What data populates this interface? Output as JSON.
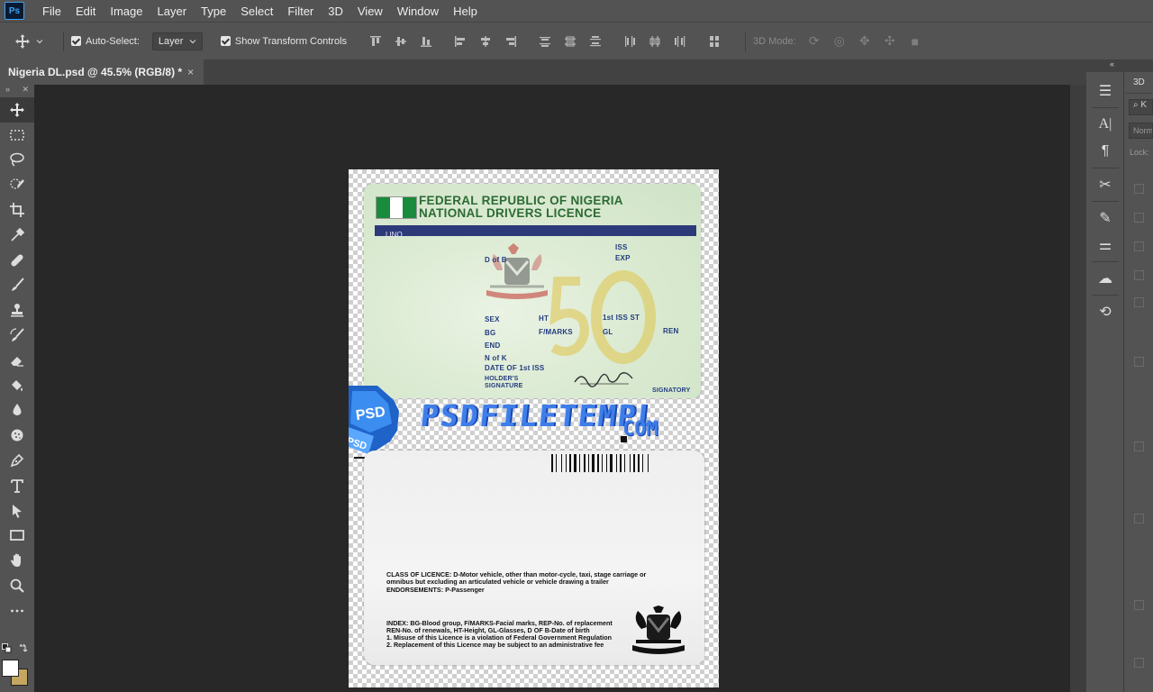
{
  "app": {
    "logo": "Ps"
  },
  "menu": [
    "File",
    "Edit",
    "Image",
    "Layer",
    "Type",
    "Select",
    "Filter",
    "3D",
    "View",
    "Window",
    "Help"
  ],
  "options": {
    "auto_select_label": "Auto-Select:",
    "auto_select_checked": true,
    "layer_select_value": "Layer",
    "show_transform_label": "Show Transform Controls",
    "show_transform_checked": true,
    "mode_3d_label": "3D Mode:"
  },
  "document": {
    "tab_title": "Nigeria DL.psd @ 45.5% (RGB/8) *",
    "tab_close": "×"
  },
  "card_front": {
    "title_line1": "FEDERAL REPUBLIC OF NIGERIA",
    "title_line2": "NATIONAL DRIVERS LICENCE",
    "lino": "LINO",
    "fields": {
      "dob": "D of B",
      "iss": "ISS",
      "exp": "EXP",
      "sex": "SEX",
      "ht": "HT",
      "first_iss_st": "1st ISS ST",
      "bg": "BG",
      "fmarks": "F/MARKS",
      "gl": "GL",
      "ren": "REN",
      "end": "END",
      "nofk": "N of K",
      "date_first_iss": "DATE OF 1st ISS",
      "holders_sig_1": "HOLDER'S",
      "holders_sig_2": "SIGNATURE",
      "signatory": "SIGNATORY"
    },
    "flag_colors": [
      "#1a8a3c",
      "#ffffff",
      "#1a8a3c"
    ],
    "title_color": "#2c6a34"
  },
  "watermark": {
    "badge": "PSD",
    "text": "PSDFILETEMPL",
    "domain": "COM",
    "color": "#3f7de8"
  },
  "card_back": {
    "class_line1": "CLASS OF LICENCE: D-Motor vehicle, other than motor-cycle, taxi, stage carriage or",
    "class_line2": "omnibus but excluding an articulated vehicle or vehicle drawing a trailer",
    "endorsements": "ENDORSEMENTS: P-Passenger",
    "index_line1": "INDEX: BG-Blood group, F/MARKS-Facial marks, REP-No. of replacement",
    "index_line2": "REN-No. of renewals, HT-Height, GL-Glasses, D OF B-Date of birth",
    "index_line3": "1. Misuse of this Licence is a violation of Federal Government Regulation",
    "index_line4": "2. Replacement of this Licence may be subject to an administrative fee"
  },
  "colors": {
    "swatch_fg": "#ffffff",
    "swatch_bg": "#c4a661",
    "ui_panel": "#535353",
    "canvas_bg": "#282828"
  },
  "right_panel": {
    "tab_3d": "3D",
    "search": "⌕ K",
    "blend_mode": "Norm",
    "lock": "Lock:",
    "collapse": "«"
  },
  "tools": [
    "move-tool",
    "marquee-tool",
    "lasso-tool",
    "quick-select-tool",
    "crop-tool",
    "eyedropper-tool",
    "healing-tool",
    "brush-tool",
    "stamp-tool",
    "history-brush-tool",
    "eraser-tool",
    "paint-bucket-tool",
    "blur-tool",
    "dodge-tool",
    "pen-tool",
    "type-tool",
    "path-select-tool",
    "rectangle-tool",
    "hand-tool",
    "zoom-tool",
    "more-tools"
  ]
}
